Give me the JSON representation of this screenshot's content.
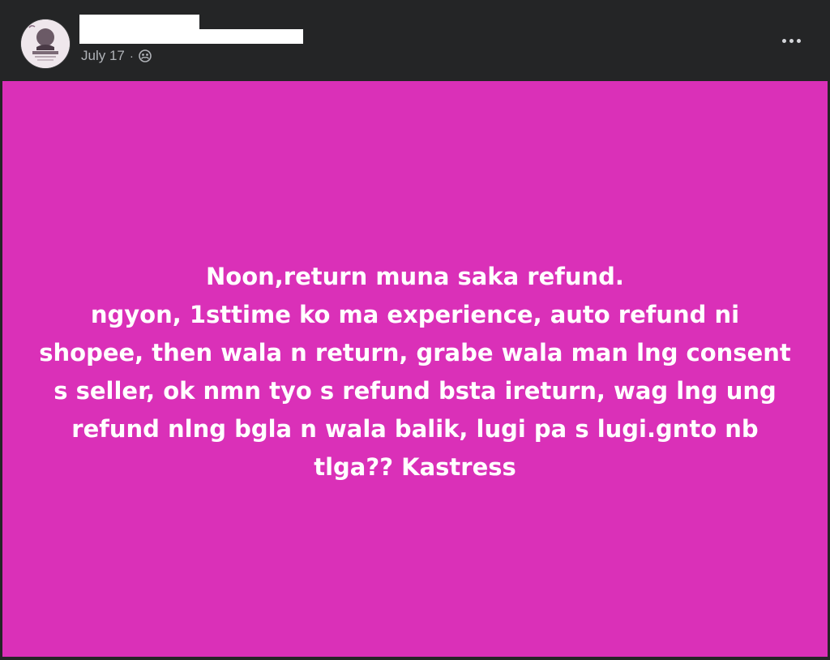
{
  "post": {
    "date": "July 17",
    "separator": "·",
    "audience_icon": "friends-globe-icon",
    "more_icon": "more-options-icon",
    "background_color": "#da30b8",
    "text_lines": [
      "Noon,return muna saka refund.",
      "ngyon, 1sttime ko ma experience, auto refund ni",
      "shopee, then wala n return, grabe wala man lng consent",
      "s seller, ok nmn tyo s refund bsta ireturn, wag lng ung",
      "refund nlng bgla n wala balik, lugi pa s lugi.gnto nb",
      "tlga?? Kastress"
    ]
  }
}
